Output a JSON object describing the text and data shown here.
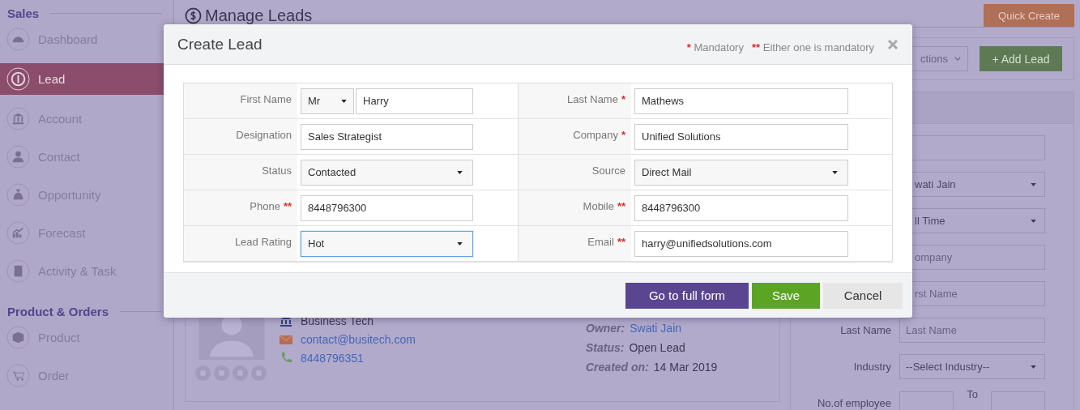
{
  "sidebar": {
    "sections": [
      {
        "title": "Sales",
        "items": [
          {
            "label": "Dashboard",
            "selected": false
          },
          {
            "label": "Lead",
            "selected": true
          },
          {
            "label": "Account",
            "selected": false
          },
          {
            "label": "Contact",
            "selected": false
          },
          {
            "label": "Opportunity",
            "selected": false
          },
          {
            "label": "Forecast",
            "selected": false
          },
          {
            "label": "Activity & Task",
            "selected": false
          }
        ]
      },
      {
        "title": "Product & Orders",
        "items": [
          {
            "label": "Product",
            "selected": false
          },
          {
            "label": "Order",
            "selected": false
          }
        ]
      }
    ]
  },
  "page": {
    "title": "Manage Leads",
    "quick_create": "Quick Create",
    "actions": "ctions",
    "add_lead": "+ Add Lead"
  },
  "lead_card": {
    "company": "Business Tech",
    "email": "contact@busitech.com",
    "phone": "8448796351",
    "details": [
      {
        "label": "Owner:",
        "value": "Swati Jain",
        "kind": "link"
      },
      {
        "label": "Status:",
        "value": "Open Lead",
        "kind": "text"
      },
      {
        "label": "Created on:",
        "value": "14 Mar 2019",
        "kind": "text"
      }
    ]
  },
  "filters": [
    {
      "kind": "input"
    },
    {
      "kind": "select",
      "value": "wati Jain"
    },
    {
      "kind": "select",
      "value": "ll Time"
    },
    {
      "kind": "input",
      "placeholder": "ompany"
    },
    {
      "kind": "input",
      "placeholder": "rst Name"
    },
    {
      "kind": "input",
      "label": "Last Name",
      "placeholder": "Last Name"
    },
    {
      "kind": "select",
      "label": "Industry",
      "value": "--Select Industry--"
    },
    {
      "kind": "range",
      "label": "No.of employee",
      "separator": "To"
    }
  ],
  "modal": {
    "title": "Create Lead",
    "legend": [
      {
        "marks": "*",
        "text": "Mandatory"
      },
      {
        "marks": "**",
        "text": "Either one is mandatory"
      }
    ],
    "rows": [
      [
        {
          "label": "First Name",
          "kind": "salutation",
          "salutation": "Mr",
          "value": "Harry",
          "focused": false
        },
        {
          "label": "Last Name",
          "required": "*",
          "kind": "input",
          "value": "Mathews",
          "focused": false
        }
      ],
      [
        {
          "label": "Designation",
          "kind": "input",
          "value": "Sales Strategist",
          "focused": false
        },
        {
          "label": "Company",
          "required": "*",
          "kind": "input",
          "value": "Unified Solutions",
          "focused": false
        }
      ],
      [
        {
          "label": "Status",
          "kind": "select",
          "value": "Contacted",
          "focused": false
        },
        {
          "label": "Source",
          "kind": "select",
          "value": "Direct Mail",
          "focused": false
        }
      ],
      [
        {
          "label": "Phone",
          "required": "**",
          "kind": "input",
          "value": "8448796300",
          "focused": false
        },
        {
          "label": "Mobile",
          "required": "**",
          "kind": "input",
          "value": "8448796300",
          "focused": false
        }
      ],
      [
        {
          "label": "Lead Rating",
          "kind": "select",
          "value": "Hot",
          "focused": true
        },
        {
          "label": "Email",
          "required": "**",
          "kind": "input",
          "value": "harry@unifiedsolutions.com",
          "focused": false
        }
      ]
    ],
    "buttons": [
      {
        "label": "Go to full form",
        "kind": "primary"
      },
      {
        "label": "Save",
        "kind": "success"
      },
      {
        "label": "Cancel",
        "kind": "default"
      }
    ]
  }
}
